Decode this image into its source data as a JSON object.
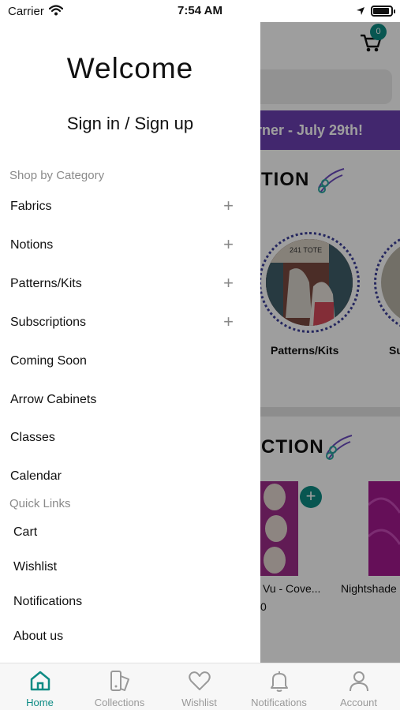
{
  "status": {
    "carrier": "Carrier",
    "time": "7:54 AM"
  },
  "background": {
    "cart_count": "0",
    "promo_text": "rner - July 29th!",
    "section1_title": "TION",
    "section2_title": "CTION",
    "category_1": "Patterns/Kits",
    "category_2": "Su",
    "category_image_text": "241 TOTE",
    "product_1_name": "Vu - Cove...",
    "product_1_price": "0",
    "product_2_name": "Nightshade",
    "add_symbol": "+"
  },
  "drawer": {
    "title": "Welcome",
    "signin": "Sign in / Sign up",
    "shop_heading": "Shop by Category",
    "categories": [
      {
        "label": "Fabrics",
        "expandable": true
      },
      {
        "label": "Notions",
        "expandable": true
      },
      {
        "label": "Patterns/Kits",
        "expandable": true
      },
      {
        "label": "Subscriptions",
        "expandable": true
      },
      {
        "label": "Coming Soon",
        "expandable": false
      },
      {
        "label": "Arrow Cabinets",
        "expandable": false
      },
      {
        "label": "Classes",
        "expandable": false
      },
      {
        "label": "Calendar",
        "expandable": false
      }
    ],
    "plus_symbol": "+",
    "quick_heading": "Quick Links",
    "quick_links": [
      "Cart",
      "Wishlist",
      "Notifications",
      "About us"
    ]
  },
  "tabbar": {
    "items": [
      {
        "label": "Home",
        "icon": "home-icon",
        "active": true
      },
      {
        "label": "Collections",
        "icon": "collections-icon",
        "active": false
      },
      {
        "label": "Wishlist",
        "icon": "heart-icon",
        "active": false
      },
      {
        "label": "Notifications",
        "icon": "bell-icon",
        "active": false
      },
      {
        "label": "Account",
        "icon": "person-icon",
        "active": false
      }
    ]
  },
  "colors": {
    "accent": "#0e8b84",
    "promo": "#6b3fb2",
    "category_ring": "#3c3f9a"
  }
}
